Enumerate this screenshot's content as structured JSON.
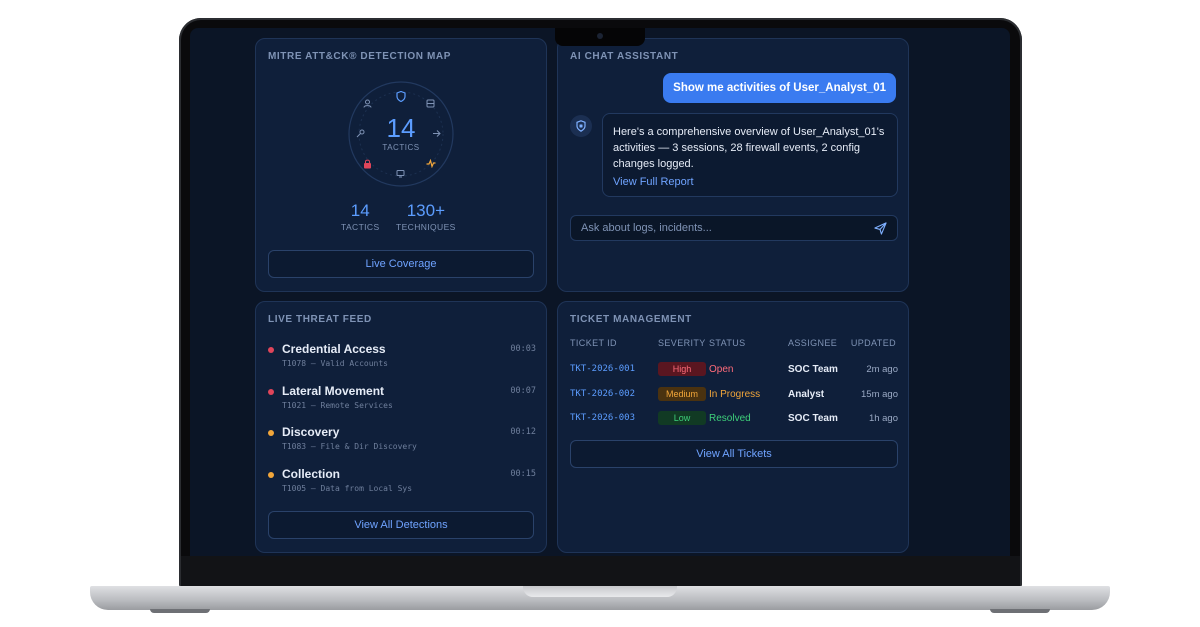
{
  "mitre": {
    "title": "MITRE ATT&CK® DETECTION MAP",
    "dial_value": "14",
    "dial_label": "TACTICS",
    "stats": [
      {
        "value": "14",
        "label": "TACTICS"
      },
      {
        "value": "130+",
        "label": "TECHNIQUES"
      }
    ],
    "button_label": "Live Coverage",
    "colors": {
      "accent": "#5c9dff",
      "lock": "#e0455a",
      "pulse": "#f2a63a"
    }
  },
  "chat": {
    "title": "AI CHAT ASSISTANT",
    "user_message": "Show me activities of User_Analyst_01",
    "bot_message": "Here's a comprehensive overview of User_Analyst_01's activities — 3 sessions, 28 firewall events, 2 config changes logged.",
    "bot_link": "View Full Report",
    "input_placeholder": "Ask about logs, incidents...",
    "input_value": ""
  },
  "feed": {
    "title": "LIVE THREAT FEED",
    "items": [
      {
        "name": "Credential Access",
        "sub": "T1078 — Valid Accounts",
        "time": "00:03",
        "color": "#e0455a"
      },
      {
        "name": "Lateral Movement",
        "sub": "T1021 — Remote Services",
        "time": "00:07",
        "color": "#e0455a"
      },
      {
        "name": "Discovery",
        "sub": "T1083 — File & Dir Discovery",
        "time": "00:12",
        "color": "#f2a63a"
      },
      {
        "name": "Collection",
        "sub": "T1005 — Data from Local Sys",
        "time": "00:15",
        "color": "#f2a63a"
      }
    ],
    "button_label": "View All Detections"
  },
  "tickets": {
    "title": "TICKET MANAGEMENT",
    "columns": [
      "TICKET ID",
      "SEVERITY",
      "STATUS",
      "ASSIGNEE",
      "UPDATED"
    ],
    "rows": [
      {
        "id": "TKT-2026-001",
        "severity": "High",
        "status": "Open",
        "assignee": "SOC Team",
        "updated": "2m ago"
      },
      {
        "id": "TKT-2026-002",
        "severity": "Medium",
        "status": "In Progress",
        "assignee": "Analyst",
        "updated": "15m ago"
      },
      {
        "id": "TKT-2026-003",
        "severity": "Low",
        "status": "Resolved",
        "assignee": "SOC Team",
        "updated": "1h ago"
      }
    ],
    "button_label": "View All Tickets",
    "severity_colors": {
      "High": {
        "bg": "#5a1620",
        "fg": "#ff6b7a"
      },
      "Medium": {
        "bg": "#4a3210",
        "fg": "#f2a63a"
      },
      "Low": {
        "bg": "#113a24",
        "fg": "#3ecf7a"
      }
    },
    "status_colors": {
      "Open": "#ff6b7a",
      "In Progress": "#f2a63a",
      "Resolved": "#3ecf7a"
    }
  }
}
